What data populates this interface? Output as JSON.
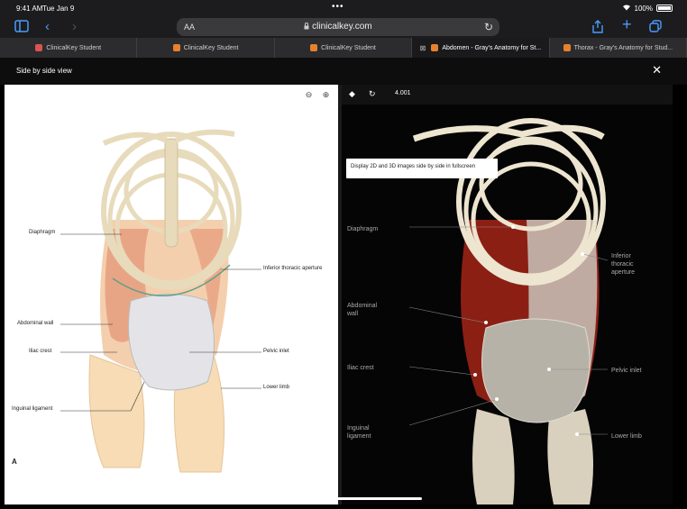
{
  "status_bar": {
    "time": "9:41 AM",
    "date": "Tue Jan 9",
    "battery": "100%"
  },
  "browser": {
    "text_size_label": "AA",
    "url": "clinicalkey.com",
    "tabs": [
      {
        "label": "ClinicalKey Student",
        "favicon_color": "#d9534f",
        "active": false
      },
      {
        "label": "ClinicalKey Student",
        "favicon_color": "#e8812d",
        "active": false
      },
      {
        "label": "ClinicalKey Student",
        "favicon_color": "#e8812d",
        "active": false
      },
      {
        "label": "Abdomen - Gray's Anatomy for St...",
        "favicon_color": "#e8812d",
        "active": true
      },
      {
        "label": "Thorax - Gray's Anatomy for Stud...",
        "favicon_color": "#e8812d",
        "active": false
      }
    ]
  },
  "viewer": {
    "title": "Side by side view",
    "tooltip": "Display 2D and 3D images side by side in fullscreen",
    "model_value": "4.001",
    "figure_letter": "A"
  },
  "left_labels": {
    "diaphragm": "Diaphragm",
    "inferior_thoracic_aperture": "Inferior thoracic aperture",
    "abdominal_wall": "Abdominal wall",
    "iliac_crest": "Iliac crest",
    "pelvic_inlet": "Pelvic inlet",
    "lower_limb": "Lower limb",
    "inguinal_ligament": "Inguinal ligament"
  },
  "right_labels": {
    "diaphragm": "Diaphragm",
    "inferior_thoracic_aperture": "Inferior\nthoracic\naperture",
    "abdominal_wall": "Abdominal\nwall",
    "iliac_crest": "Iliac crest",
    "pelvic_inlet": "Pelvic inlet",
    "inguinal_ligament": "Inguinal\nligament",
    "lower_limb": "Lower limb"
  },
  "colors": {
    "browser_accent": "#4a9cff",
    "muscle": "#c0392b",
    "bone": "#e8dcc0"
  }
}
